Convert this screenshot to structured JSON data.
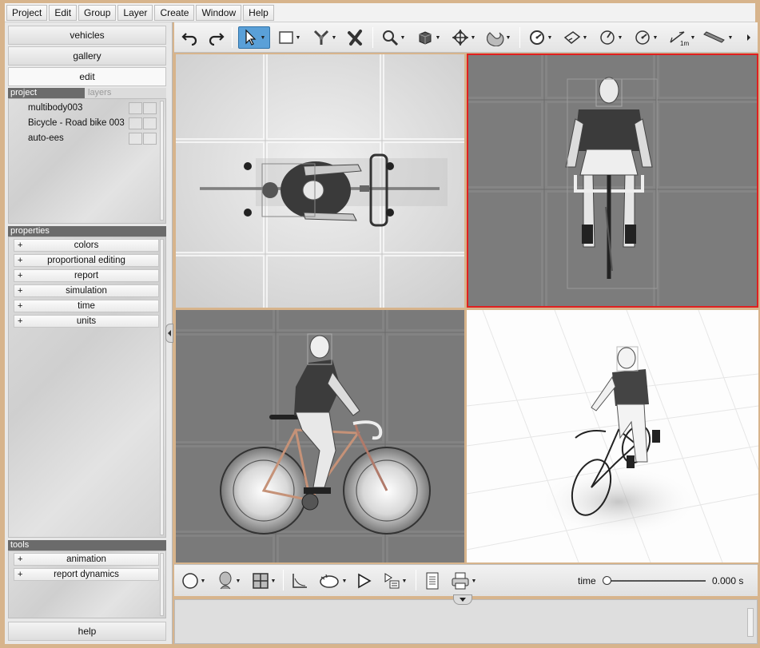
{
  "menubar": {
    "items": [
      "Project",
      "Edit",
      "Group",
      "Layer",
      "Create",
      "Window",
      "Help"
    ]
  },
  "sidebar": {
    "nav": {
      "vehicles": "vehicles",
      "gallery": "gallery",
      "edit": "edit"
    },
    "project_tabs": {
      "project": "project",
      "layers": "layers"
    },
    "project_items": [
      "multibody003",
      "Bicycle - Road bike 003",
      "auto-ees"
    ],
    "properties_title": "properties",
    "properties": [
      "colors",
      "proportional editing",
      "report",
      "simulation",
      "time",
      "units"
    ],
    "tools_title": "tools",
    "tools": [
      "animation",
      "report dynamics"
    ],
    "expand_symbol": "+",
    "help": "help"
  },
  "toolbar": {
    "icons": [
      "undo-icon",
      "redo-icon",
      "select-arrow-icon",
      "rectangle-select-icon",
      "joint-icon",
      "delete-icon",
      "zoom-icon",
      "box-icon",
      "move-icon",
      "magnet-icon",
      "disc-icon",
      "plane-icon",
      "gauge-icon",
      "dial-icon",
      "ruler-icon",
      "pen-icon"
    ],
    "active": "select-arrow-icon",
    "ruler_label": "1m"
  },
  "bottombar": {
    "time_label": "time",
    "time_value": "0.000 s",
    "time_fraction": 0
  },
  "colors": {
    "active_viewport_border": "#e02020",
    "selected_tool": "#5aa0d8"
  }
}
